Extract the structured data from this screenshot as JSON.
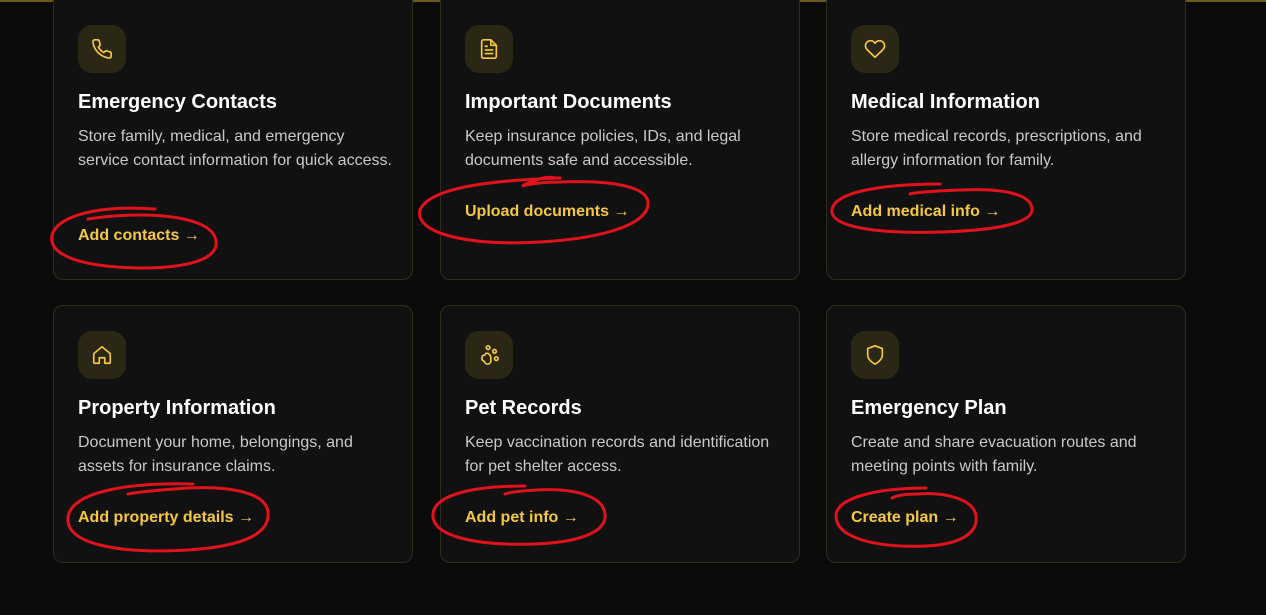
{
  "colors": {
    "background": "#0b0b0b",
    "card": "#111111",
    "accent": "#f5c842",
    "annotation": "#e0121b"
  },
  "cards": [
    {
      "icon": "phone-icon",
      "title": "Emergency Contacts",
      "description": "Store family, medical, and emergency service contact information for quick access.",
      "link": "Add contacts →"
    },
    {
      "icon": "document-icon",
      "title": "Important Documents",
      "description": "Keep insurance policies, IDs, and legal documents safe and accessible.",
      "link": "Upload documents →"
    },
    {
      "icon": "heart-icon",
      "title": "Medical Information",
      "description": "Store medical records, prescriptions, and allergy information for family.",
      "link": "Add medical info →"
    },
    {
      "icon": "home-icon",
      "title": "Property Information",
      "description": "Document your home, belongings, and assets for insurance claims.",
      "link": "Add property details →"
    },
    {
      "icon": "paw-icon",
      "title": "Pet Records",
      "description": "Keep vaccination records and identification for pet shelter access.",
      "link": "Add pet info →"
    },
    {
      "icon": "shield-icon",
      "title": "Emergency Plan",
      "description": "Create and share evacuation routes and meeting points with family.",
      "link": "Create plan →"
    }
  ]
}
